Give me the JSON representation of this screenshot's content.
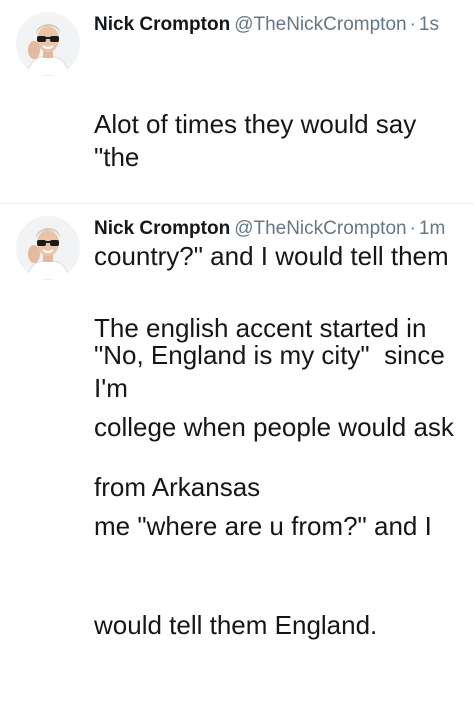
{
  "tweets": [
    {
      "author": {
        "name": "Nick Crompton",
        "handle": "@TheNickCrompton",
        "avatar_icon": "profile-photo-sunglasses"
      },
      "separator": "·",
      "time": "1s",
      "lines": [
        "Alot of times they would say \"the",
        "country?\" and I would tell them",
        "\"No, England is my city\"  since I'm",
        "from Arkansas"
      ]
    },
    {
      "author": {
        "name": "Nick Crompton",
        "handle": "@TheNickCrompton",
        "avatar_icon": "profile-photo-sunglasses"
      },
      "separator": "·",
      "time": "1m",
      "lines": [
        "The english accent started in",
        "college when people would ask",
        "me \"where are u from?\" and I",
        "would tell them England."
      ]
    }
  ],
  "colors": {
    "text": "#14171a",
    "secondary": "#657786",
    "divider": "#e6ecf0"
  }
}
